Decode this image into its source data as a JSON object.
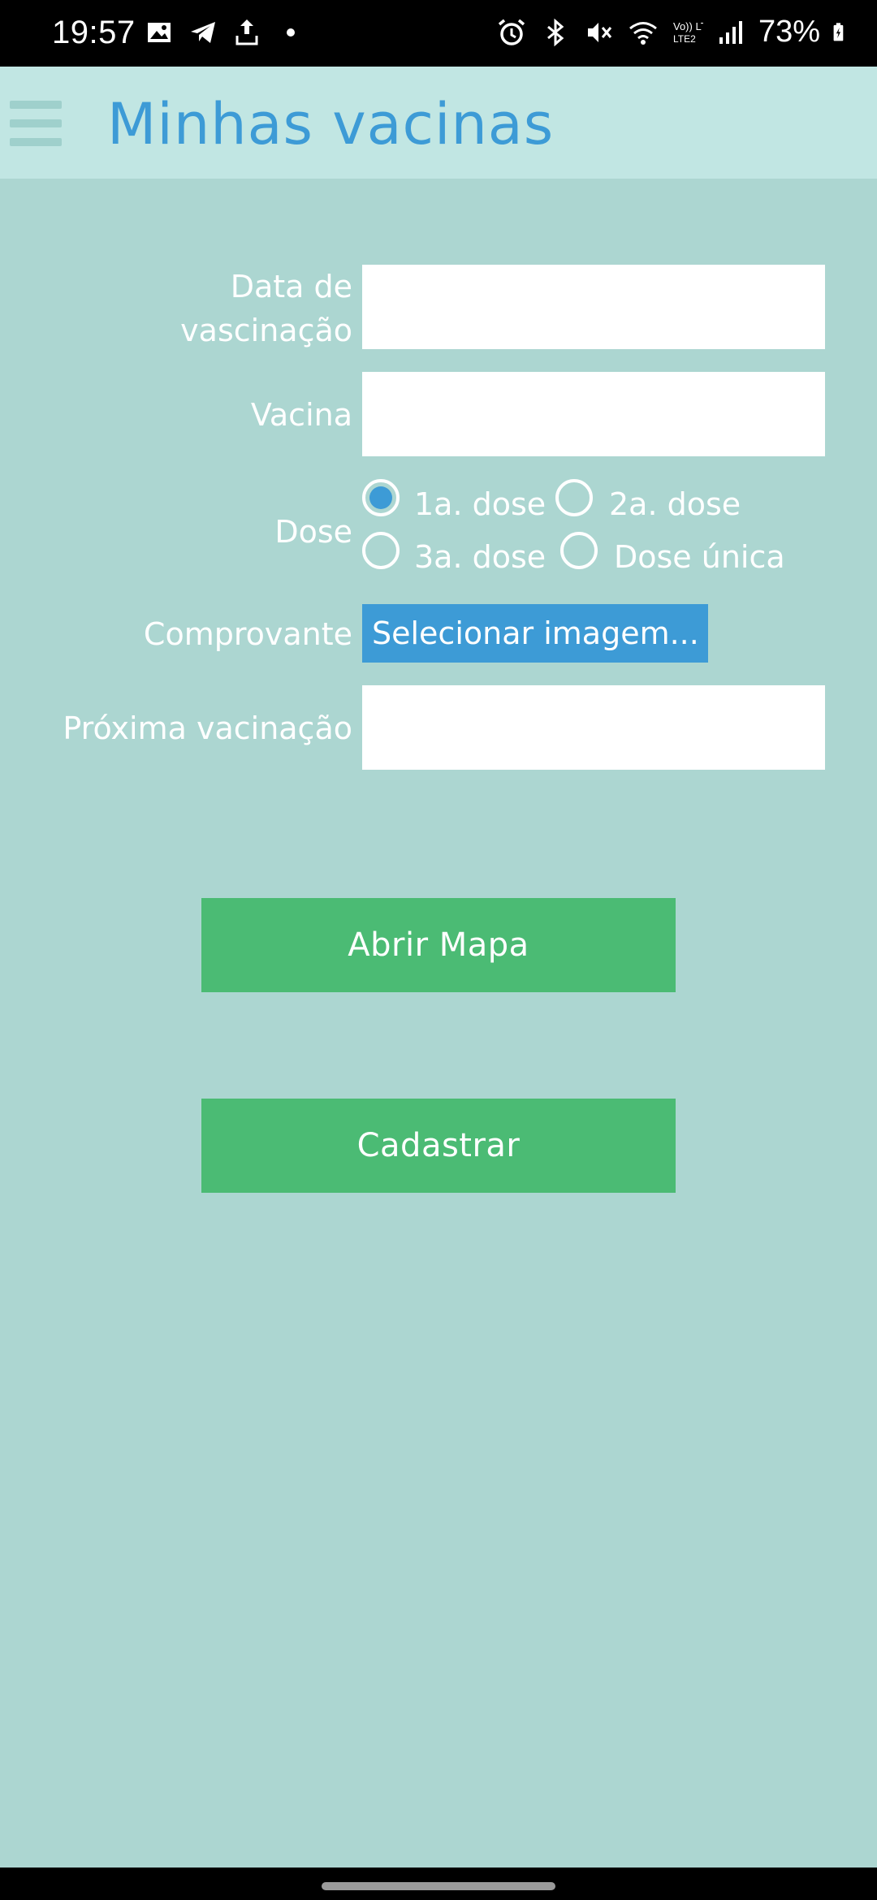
{
  "status_bar": {
    "time": "19:57",
    "battery": "73%",
    "left_icons": [
      "image-icon",
      "telegram-icon",
      "upload-icon",
      "dot-icon"
    ],
    "right_icons": [
      "alarm-icon",
      "bluetooth-icon",
      "mute-icon",
      "wifi-icon",
      "volte-icon",
      "signal-icon",
      "battery-icon"
    ],
    "volte_label": "Vo)) LTE2"
  },
  "header": {
    "title": "Minhas vacinas",
    "menu_icon": "hamburger-menu-icon"
  },
  "form": {
    "date_label_line1": "Data de",
    "date_label_line2": "vascinação",
    "date_value": "",
    "vaccine_label": "Vacina",
    "vaccine_value": "",
    "dose_label": "Dose",
    "dose_options": [
      "1a. dose",
      "2a. dose",
      "3a. dose",
      "Dose única"
    ],
    "dose_selected": "1a. dose",
    "proof_label": "Comprovante",
    "proof_button": "Selecionar imagem...",
    "next_label": "Próxima vacinação",
    "next_value": ""
  },
  "buttons": {
    "open_map": "Abrir Mapa",
    "register": "Cadastrar"
  },
  "colors": {
    "background": "#acd6d1",
    "header": "#c1e6e3",
    "title": "#3d9bd6",
    "accent_blue": "#3d9bd6",
    "button_green": "#4bbb74"
  }
}
